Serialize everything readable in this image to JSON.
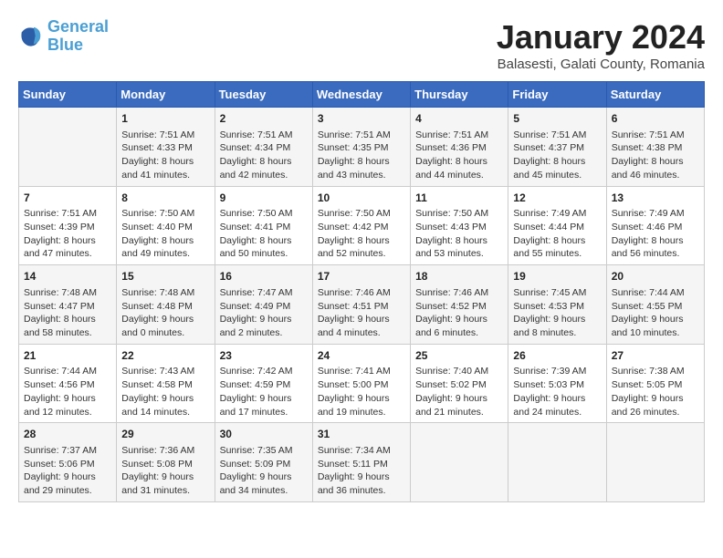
{
  "header": {
    "logo_line1": "General",
    "logo_line2": "Blue",
    "title": "January 2024",
    "subtitle": "Balasesti, Galati County, Romania"
  },
  "weekdays": [
    "Sunday",
    "Monday",
    "Tuesday",
    "Wednesday",
    "Thursday",
    "Friday",
    "Saturday"
  ],
  "weeks": [
    [
      {
        "day": "",
        "content": ""
      },
      {
        "day": "1",
        "content": "Sunrise: 7:51 AM\nSunset: 4:33 PM\nDaylight: 8 hours\nand 41 minutes."
      },
      {
        "day": "2",
        "content": "Sunrise: 7:51 AM\nSunset: 4:34 PM\nDaylight: 8 hours\nand 42 minutes."
      },
      {
        "day": "3",
        "content": "Sunrise: 7:51 AM\nSunset: 4:35 PM\nDaylight: 8 hours\nand 43 minutes."
      },
      {
        "day": "4",
        "content": "Sunrise: 7:51 AM\nSunset: 4:36 PM\nDaylight: 8 hours\nand 44 minutes."
      },
      {
        "day": "5",
        "content": "Sunrise: 7:51 AM\nSunset: 4:37 PM\nDaylight: 8 hours\nand 45 minutes."
      },
      {
        "day": "6",
        "content": "Sunrise: 7:51 AM\nSunset: 4:38 PM\nDaylight: 8 hours\nand 46 minutes."
      }
    ],
    [
      {
        "day": "7",
        "content": "Sunrise: 7:51 AM\nSunset: 4:39 PM\nDaylight: 8 hours\nand 47 minutes."
      },
      {
        "day": "8",
        "content": "Sunrise: 7:50 AM\nSunset: 4:40 PM\nDaylight: 8 hours\nand 49 minutes."
      },
      {
        "day": "9",
        "content": "Sunrise: 7:50 AM\nSunset: 4:41 PM\nDaylight: 8 hours\nand 50 minutes."
      },
      {
        "day": "10",
        "content": "Sunrise: 7:50 AM\nSunset: 4:42 PM\nDaylight: 8 hours\nand 52 minutes."
      },
      {
        "day": "11",
        "content": "Sunrise: 7:50 AM\nSunset: 4:43 PM\nDaylight: 8 hours\nand 53 minutes."
      },
      {
        "day": "12",
        "content": "Sunrise: 7:49 AM\nSunset: 4:44 PM\nDaylight: 8 hours\nand 55 minutes."
      },
      {
        "day": "13",
        "content": "Sunrise: 7:49 AM\nSunset: 4:46 PM\nDaylight: 8 hours\nand 56 minutes."
      }
    ],
    [
      {
        "day": "14",
        "content": "Sunrise: 7:48 AM\nSunset: 4:47 PM\nDaylight: 8 hours\nand 58 minutes."
      },
      {
        "day": "15",
        "content": "Sunrise: 7:48 AM\nSunset: 4:48 PM\nDaylight: 9 hours\nand 0 minutes."
      },
      {
        "day": "16",
        "content": "Sunrise: 7:47 AM\nSunset: 4:49 PM\nDaylight: 9 hours\nand 2 minutes."
      },
      {
        "day": "17",
        "content": "Sunrise: 7:46 AM\nSunset: 4:51 PM\nDaylight: 9 hours\nand 4 minutes."
      },
      {
        "day": "18",
        "content": "Sunrise: 7:46 AM\nSunset: 4:52 PM\nDaylight: 9 hours\nand 6 minutes."
      },
      {
        "day": "19",
        "content": "Sunrise: 7:45 AM\nSunset: 4:53 PM\nDaylight: 9 hours\nand 8 minutes."
      },
      {
        "day": "20",
        "content": "Sunrise: 7:44 AM\nSunset: 4:55 PM\nDaylight: 9 hours\nand 10 minutes."
      }
    ],
    [
      {
        "day": "21",
        "content": "Sunrise: 7:44 AM\nSunset: 4:56 PM\nDaylight: 9 hours\nand 12 minutes."
      },
      {
        "day": "22",
        "content": "Sunrise: 7:43 AM\nSunset: 4:58 PM\nDaylight: 9 hours\nand 14 minutes."
      },
      {
        "day": "23",
        "content": "Sunrise: 7:42 AM\nSunset: 4:59 PM\nDaylight: 9 hours\nand 17 minutes."
      },
      {
        "day": "24",
        "content": "Sunrise: 7:41 AM\nSunset: 5:00 PM\nDaylight: 9 hours\nand 19 minutes."
      },
      {
        "day": "25",
        "content": "Sunrise: 7:40 AM\nSunset: 5:02 PM\nDaylight: 9 hours\nand 21 minutes."
      },
      {
        "day": "26",
        "content": "Sunrise: 7:39 AM\nSunset: 5:03 PM\nDaylight: 9 hours\nand 24 minutes."
      },
      {
        "day": "27",
        "content": "Sunrise: 7:38 AM\nSunset: 5:05 PM\nDaylight: 9 hours\nand 26 minutes."
      }
    ],
    [
      {
        "day": "28",
        "content": "Sunrise: 7:37 AM\nSunset: 5:06 PM\nDaylight: 9 hours\nand 29 minutes."
      },
      {
        "day": "29",
        "content": "Sunrise: 7:36 AM\nSunset: 5:08 PM\nDaylight: 9 hours\nand 31 minutes."
      },
      {
        "day": "30",
        "content": "Sunrise: 7:35 AM\nSunset: 5:09 PM\nDaylight: 9 hours\nand 34 minutes."
      },
      {
        "day": "31",
        "content": "Sunrise: 7:34 AM\nSunset: 5:11 PM\nDaylight: 9 hours\nand 36 minutes."
      },
      {
        "day": "",
        "content": ""
      },
      {
        "day": "",
        "content": ""
      },
      {
        "day": "",
        "content": ""
      }
    ]
  ]
}
